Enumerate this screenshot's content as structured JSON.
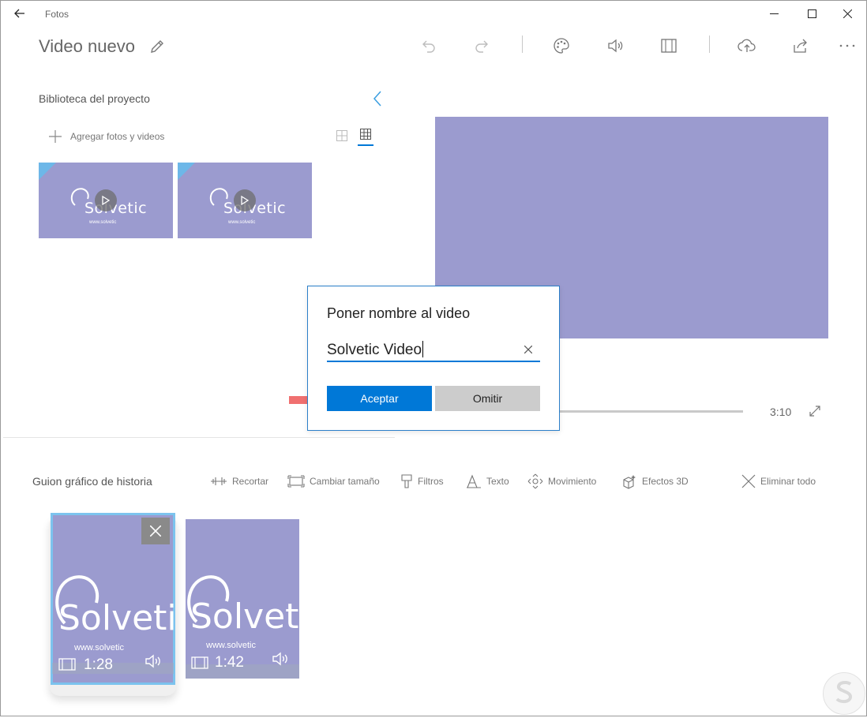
{
  "window": {
    "app_title": "Fotos"
  },
  "header": {
    "title": "Video nuevo"
  },
  "library": {
    "title": "Biblioteca del proyecto",
    "add_label": "Agregar fotos y videos",
    "thumbnails": [
      {
        "logo": "Solvetic",
        "url": "www.solvetic"
      },
      {
        "logo": "Solvetic",
        "url": "www.solvetic"
      }
    ]
  },
  "player": {
    "duration": "3:10"
  },
  "dialog": {
    "title": "Poner nombre al video",
    "input_value": "Solvetic Video",
    "accept_label": "Aceptar",
    "skip_label": "Omitir"
  },
  "storyboard": {
    "title": "Guion gráfico de historia",
    "tools": {
      "trim": "Recortar",
      "resize": "Cambiar tamaño",
      "filters": "Filtros",
      "text": "Texto",
      "motion": "Movimiento",
      "effects3d": "Efectos 3D",
      "remove_all": "Eliminar todo"
    },
    "cards": [
      {
        "logo": "Solvetic",
        "url": "www.solvetic",
        "duration": "1:28"
      },
      {
        "logo": "Solvetic",
        "url": "www.solvetic",
        "duration": "1:42"
      }
    ]
  },
  "colors": {
    "accent": "#0078d7",
    "thumbnail": "#9b9bcf",
    "arrow": "#f07070"
  }
}
